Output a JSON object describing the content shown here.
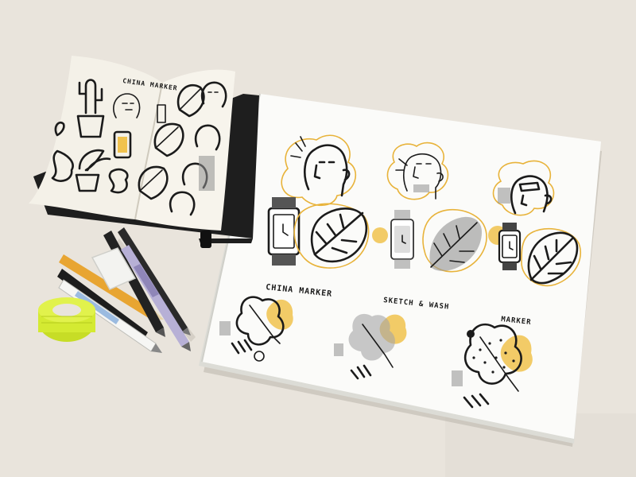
{
  "sketchbook": {
    "label_china_marker": "CHINA MARKER"
  },
  "sheet": {
    "labels": {
      "china_marker": "CHINA MARKER",
      "sketch_wash": "SKETCH & WASH",
      "marker": "MARKER"
    }
  },
  "colors": {
    "desk": "#e9e4dc",
    "paper": "#fbfbf9",
    "accent_yellow": "#f0c24e",
    "ink": "#1b1b1b",
    "grey_wash": "#8f8f8f",
    "tape_green": "#d4ea32"
  },
  "tools": [
    "pencil",
    "eraser",
    "marker-pens",
    "paint-pens",
    "tape-roll"
  ]
}
